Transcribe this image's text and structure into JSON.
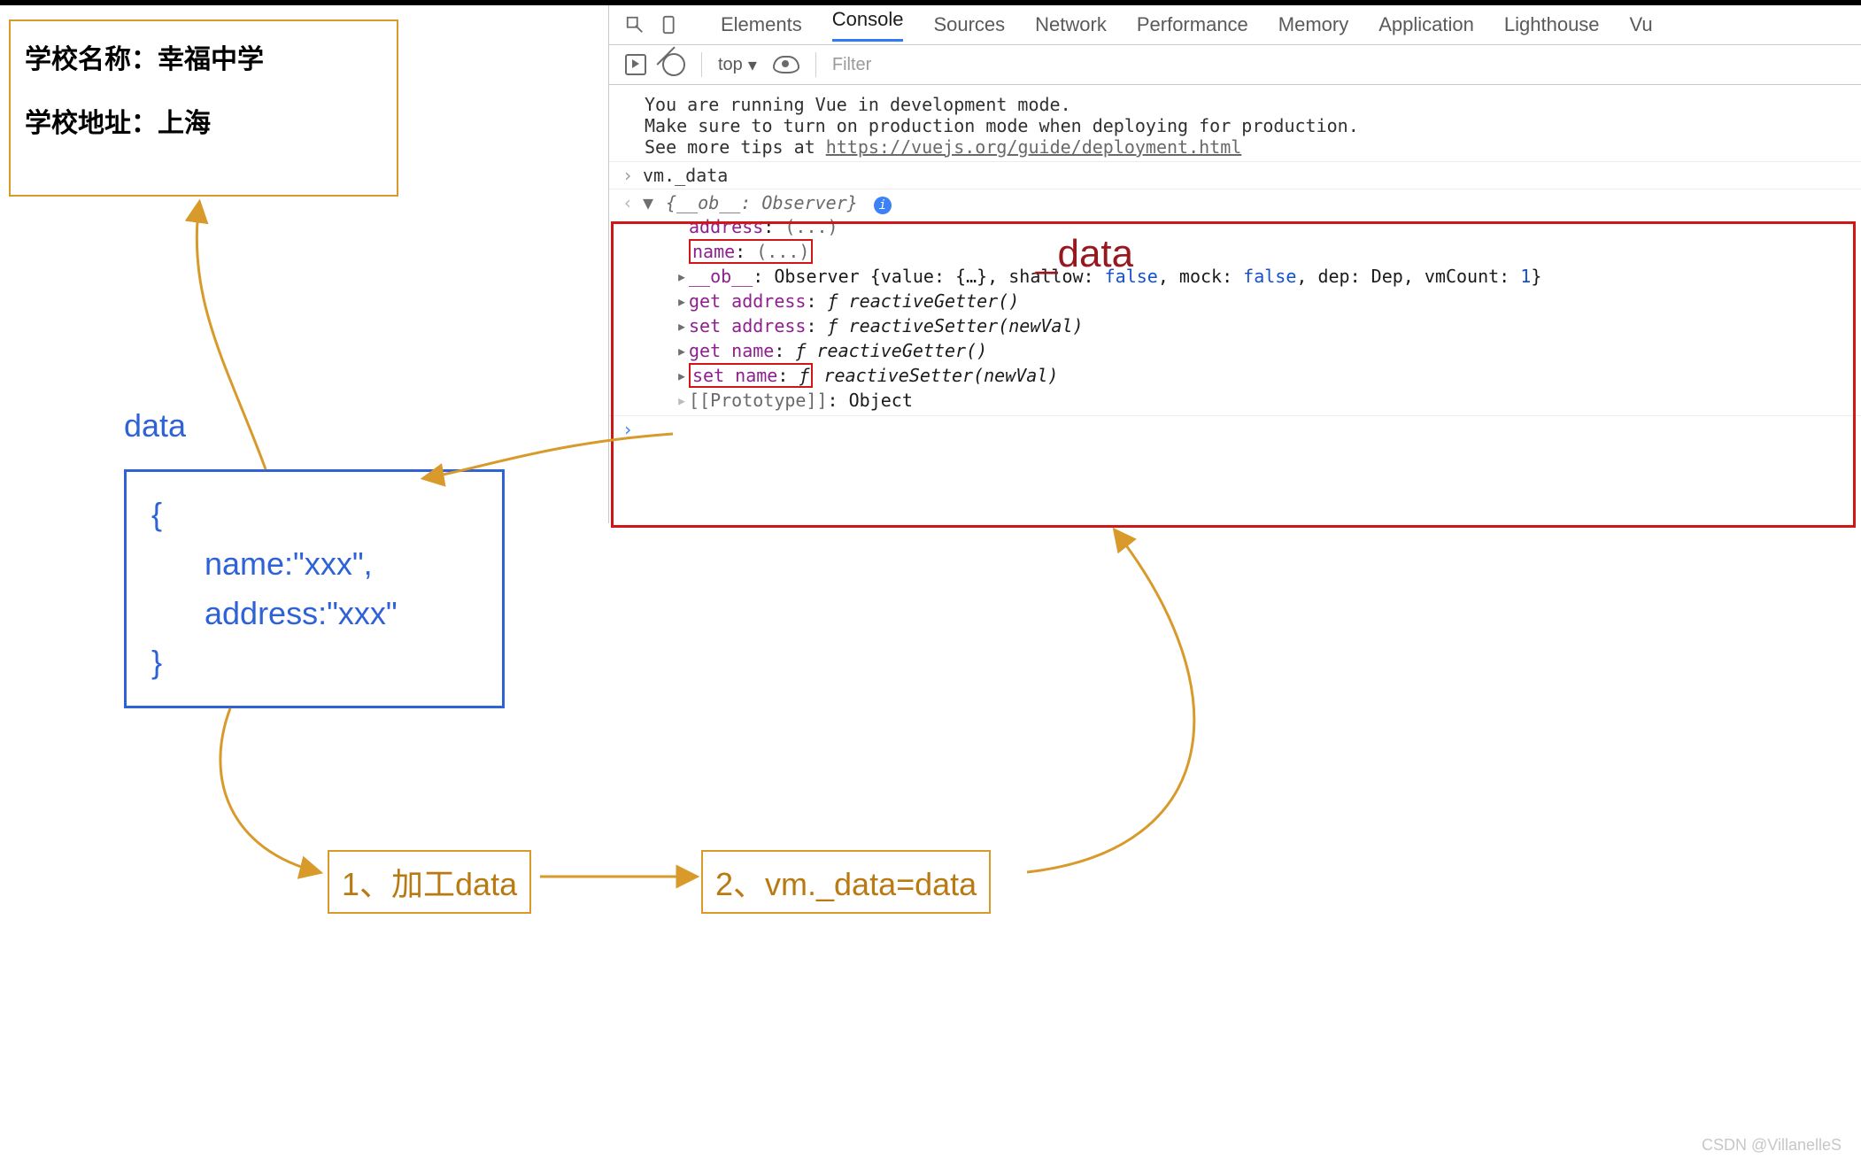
{
  "app_output": {
    "line1_label": "学校名称：",
    "line1_value": "幸福中学",
    "line2_label": "学校地址：",
    "line2_value": "上海"
  },
  "data_section": {
    "heading": "data",
    "open": "{",
    "line_name": "name:\"xxx\",",
    "line_address": "address:\"xxx\"",
    "close": "}"
  },
  "steps": {
    "step1": "1、加工data",
    "step2": "2、vm._data=data"
  },
  "red_title": "_data",
  "devtools": {
    "tabs": [
      "Elements",
      "Console",
      "Sources",
      "Network",
      "Performance",
      "Memory",
      "Application",
      "Lighthouse",
      "Vu"
    ],
    "active_tab": "Console",
    "scope_label": "top",
    "filter_placeholder": "Filter",
    "warn_line1": "You are running Vue in development mode.",
    "warn_line2": "Make sure to turn on production mode when deploying for production.",
    "warn_line3_prefix": "See more tips at ",
    "warn_link": "https://vuejs.org/guide/deployment.html",
    "input_echo": "vm._data",
    "object_head_prefix": "{__ob__: ",
    "object_head_type": "Observer",
    "object_head_suffix": "}",
    "prop_address": "address",
    "prop_name": "name",
    "ellipsis": "(...)",
    "ob_key": "__ob__",
    "ob_value": "Observer {value: {…}, shallow: ",
    "ob_false": "false",
    "ob_mid1": ", mock: ",
    "ob_mid2": ", dep: Dep, vmCount: ",
    "ob_one": "1",
    "ob_tail": "}",
    "get_addr_k": "get address",
    "set_addr_k": "set address",
    "get_name_k": "get name",
    "set_name_k": "set name",
    "f": "ƒ",
    "getter_sig": "reactiveGetter()",
    "setter_sig": "reactiveSetter(newVal)",
    "proto_k": "[[Prototype]]",
    "proto_v": "Object"
  },
  "watermark": "CSDN @VillanelleS"
}
